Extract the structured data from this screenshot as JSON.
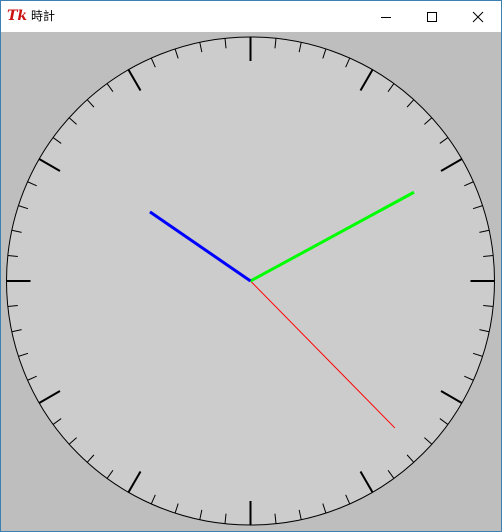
{
  "window": {
    "title": "時計",
    "app_icon_text": "Tk",
    "controls": [
      "minimize",
      "maximize",
      "close"
    ]
  },
  "clock": {
    "face_color": "#cccccc",
    "background_color": "#bebebe",
    "tick_color": "#000000",
    "hands": {
      "hour": {
        "color": "#0000ff",
        "angle_deg": 304.5
      },
      "minute": {
        "color": "#00ff00",
        "angle_deg": 61.5
      },
      "second": {
        "color": "#ff0000",
        "angle_deg": 135.5
      }
    }
  }
}
